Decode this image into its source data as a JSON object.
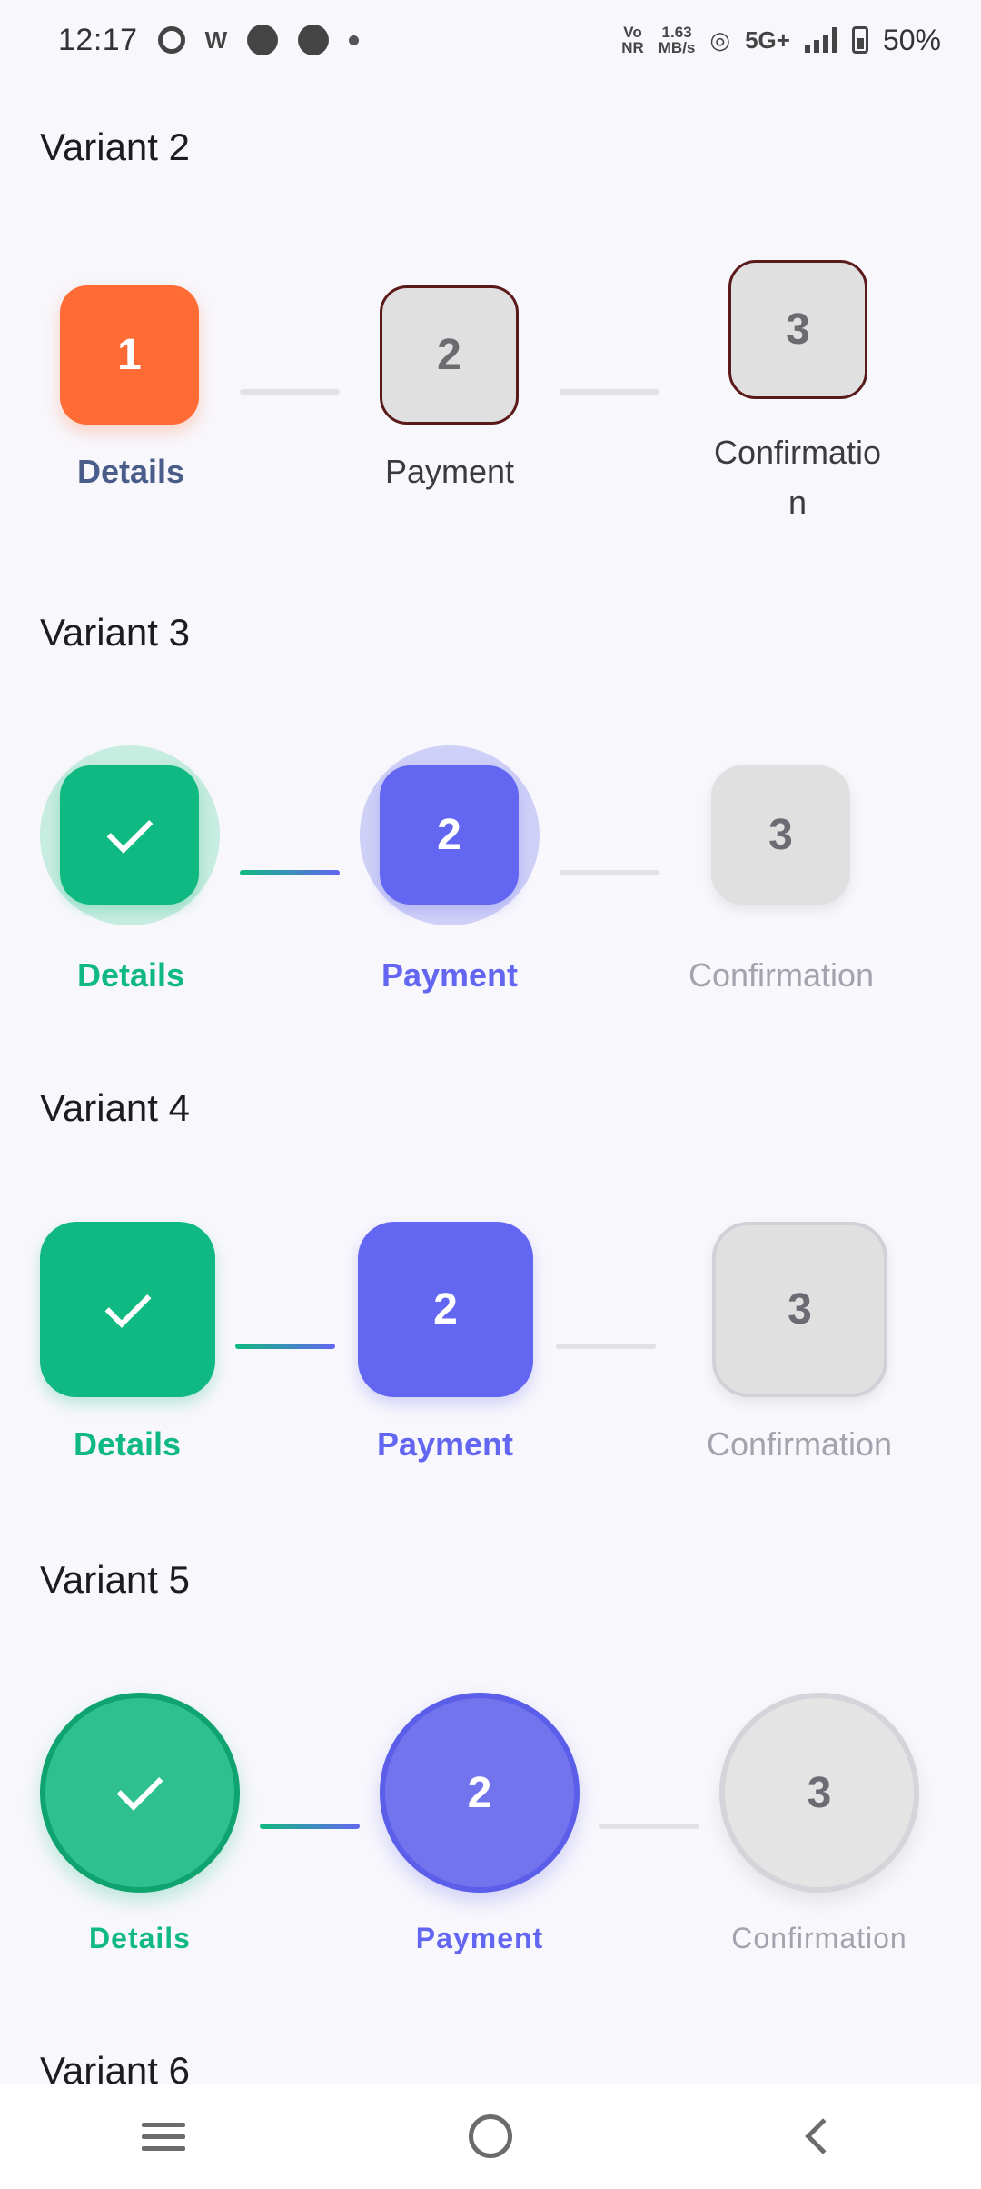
{
  "status_bar": {
    "time": "12:17",
    "vonr": "Vo\nNR",
    "net_speed_value": "1.63",
    "net_speed_unit": "MB/s",
    "network": "5G+",
    "battery": "50%"
  },
  "variants": [
    {
      "title": "Variant 2",
      "steps": [
        {
          "number": "1",
          "label": "Details",
          "state": "active"
        },
        {
          "number": "2",
          "label": "Payment",
          "state": "inactive"
        },
        {
          "number": "3",
          "label": "Confirmatio\nn",
          "state": "inactive"
        }
      ]
    },
    {
      "title": "Variant 3",
      "steps": [
        {
          "number": "",
          "label": "Details",
          "state": "completed"
        },
        {
          "number": "2",
          "label": "Payment",
          "state": "current"
        },
        {
          "number": "3",
          "label": "Confirmation",
          "state": "upcoming"
        }
      ]
    },
    {
      "title": "Variant 4",
      "steps": [
        {
          "number": "",
          "label": "Details",
          "state": "completed"
        },
        {
          "number": "2",
          "label": "Payment",
          "state": "current"
        },
        {
          "number": "3",
          "label": "Confirmation",
          "state": "upcoming"
        }
      ]
    },
    {
      "title": "Variant 5",
      "steps": [
        {
          "number": "",
          "label": "Details",
          "state": "completed"
        },
        {
          "number": "2",
          "label": "Payment",
          "state": "current"
        },
        {
          "number": "3",
          "label": "Confirmation",
          "state": "upcoming"
        }
      ]
    },
    {
      "title": "Variant 6",
      "steps": []
    }
  ],
  "colors": {
    "completed": "#10b981",
    "current": "#6366f1",
    "upcoming": "#e0e0e0",
    "active_orange": "#ff6b35"
  },
  "nav": {
    "menu_icon": "menu-icon",
    "home_icon": "home-icon",
    "back_icon": "back-icon"
  }
}
